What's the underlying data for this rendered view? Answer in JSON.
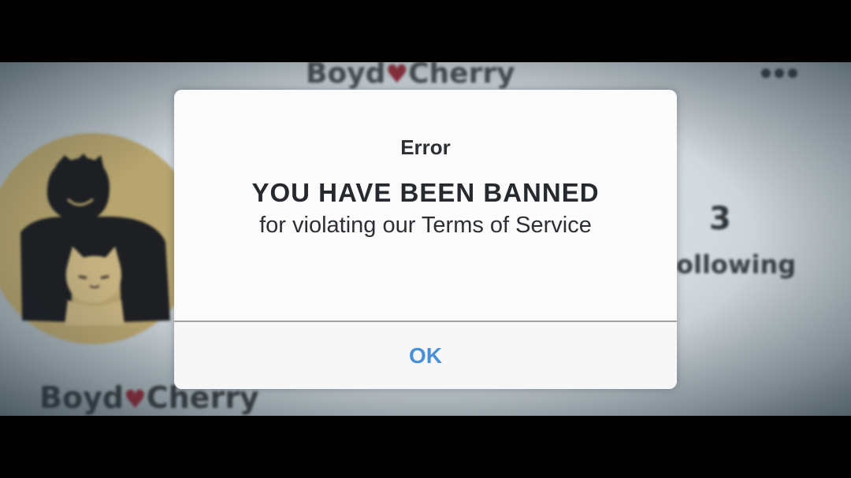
{
  "profile": {
    "header_name_left": "Boyd",
    "header_name_right": "Cherry",
    "heart": "♥",
    "more_icon": "more-horizontal-icon",
    "avatar_icon": "profile-avatar-icon",
    "following_count": "3",
    "following_label": "ollowing",
    "footer_name_left": "Boyd",
    "footer_name_right": "Cherry"
  },
  "dialog": {
    "title": "Error",
    "headline": "YOU HAVE BEEN BANNED",
    "message": "for violating our Terms of Service",
    "ok_label": "OK"
  },
  "colors": {
    "accent": "#4a90d6",
    "heart": "#8f2f3b",
    "avatar_bg": "#b7a46e"
  }
}
